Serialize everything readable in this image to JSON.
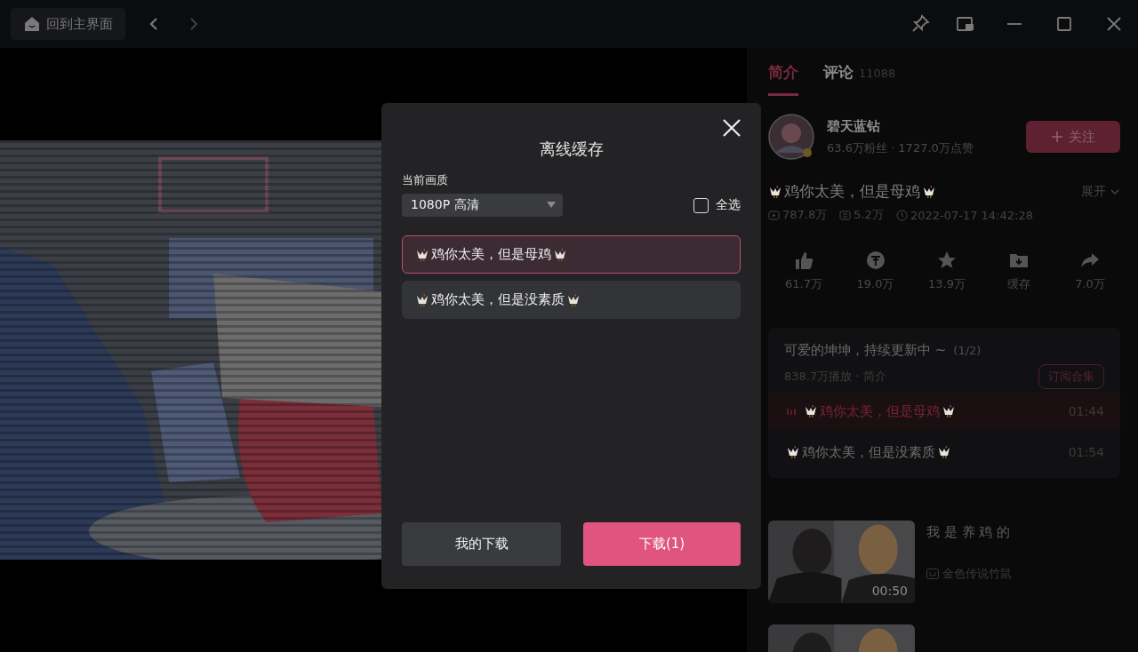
{
  "title_bar": {
    "home_button": "回到主界面",
    "nav": [
      {
        "kind": "back",
        "disabled": false
      },
      {
        "kind": "forward",
        "disabled": true
      }
    ],
    "window_controls": [
      {
        "kind": "pin"
      },
      {
        "kind": "mini-window"
      },
      {
        "kind": "minimize"
      },
      {
        "kind": "maximize"
      },
      {
        "kind": "close"
      }
    ]
  },
  "player": {
    "kind": "picture"
  },
  "side_panel": {
    "tabs": [
      {
        "label": "简介",
        "selected": true
      },
      {
        "label": "评论",
        "count": "11088",
        "selected": false
      }
    ],
    "author": {
      "name": "碧天蓝钻",
      "stats": "63.6万粉丝 · 1727.0万点赞",
      "follow_button": "关注"
    },
    "video": {
      "title": "鸡你太美，但是母鸡",
      "expand": "展开",
      "plays": "787.8万",
      "danmaku": "5.2万",
      "date": "2022-07-17 14:42:28"
    },
    "actions": [
      {
        "kind": "like",
        "label": "61.7万"
      },
      {
        "kind": "coin",
        "label": "19.0万"
      },
      {
        "kind": "star",
        "label": "13.9万"
      },
      {
        "kind": "cache",
        "label": "缓存"
      },
      {
        "kind": "share",
        "label": "7.0万"
      }
    ],
    "collection": {
      "title": "可爱的坤坤，持续更新中 ~",
      "episode_count": "(1/2)",
      "meta": "838.7万播放 · 简介",
      "subscribe": "订阅合集",
      "episodes": [
        {
          "title": "鸡你太美，但是母鸡",
          "duration": "01:44",
          "selected": true
        },
        {
          "title": "鸡你太美，但是没素质",
          "duration": "01:54",
          "selected": false
        }
      ]
    },
    "related": [
      {
        "kind": "picture",
        "title": "我 是 养 鸡 的",
        "author": "金色传说竹鼠",
        "duration": "00:50"
      },
      {
        "kind": "picture"
      }
    ]
  },
  "modal": {
    "title": "离线缓存",
    "quality_label": "当前画质",
    "quality": "1080P 高清",
    "select_all": {
      "label": "全选",
      "checked": false
    },
    "episodes": [
      {
        "title": "鸡你太美，但是母鸡",
        "selected": true
      },
      {
        "title": "鸡你太美，但是没素质",
        "selected": false
      }
    ],
    "buttons": [
      {
        "label": "我的下载",
        "kind": "secondary"
      },
      {
        "label": "下载(1)",
        "kind": "primary"
      }
    ]
  }
}
